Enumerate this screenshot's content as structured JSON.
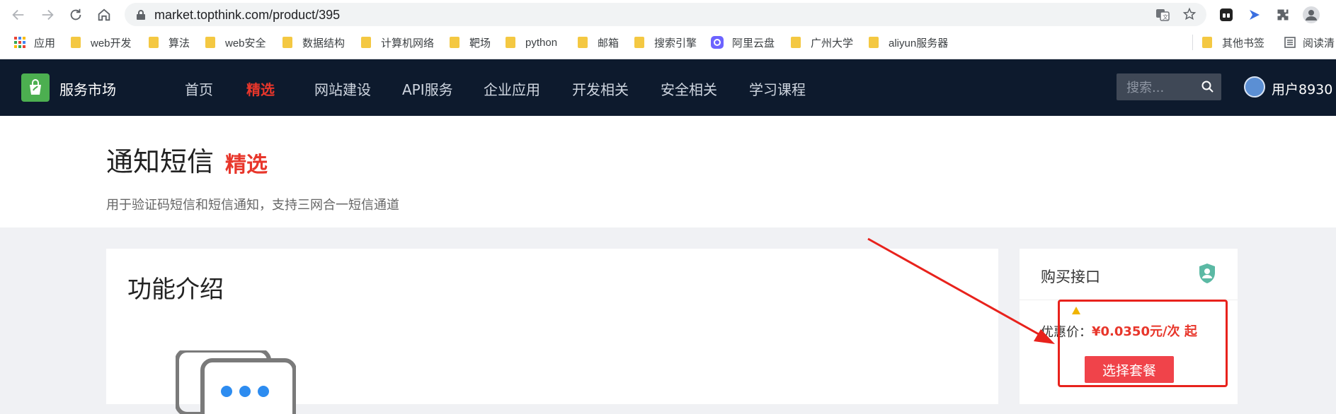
{
  "browser": {
    "url": "market.topthink.com/product/395",
    "bookmarks": [
      "应用",
      "web开发",
      "算法",
      "web安全",
      "数据结构",
      "计算机网络",
      "靶场",
      "python",
      "邮箱",
      "搜索引擎",
      "阿里云盘",
      "广州大学",
      "aliyun服务器"
    ],
    "other_bookmarks": "其他书签",
    "reading_list": "阅读清"
  },
  "header": {
    "brand": "服务市场",
    "nav": [
      "首页",
      "精选",
      "网站建设",
      "API服务",
      "企业应用",
      "开发相关",
      "安全相关",
      "学习课程"
    ],
    "active_nav": "精选",
    "search_placeholder": "搜索...",
    "username": "用户8930"
  },
  "hero": {
    "title": "通知短信",
    "badge": "精选",
    "description": "用于验证码短信和短信通知，支持三网合一短信通道"
  },
  "main": {
    "section_title": "功能介绍"
  },
  "purchase": {
    "title": "购买接口",
    "price_label": "优惠价：",
    "price": "¥0.0350元/次 起",
    "button": "选择套餐"
  },
  "colors": {
    "header_bg": "#0d1a2d",
    "accent_red": "#e8362b",
    "button_red": "#f0434a"
  }
}
